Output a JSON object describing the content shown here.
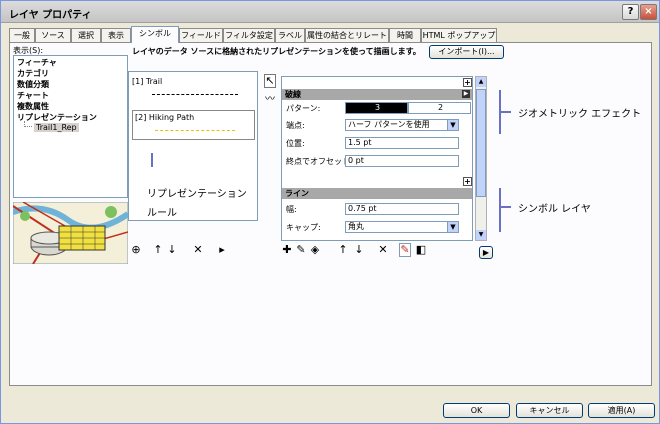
{
  "window": {
    "title": "レイヤ プロパティ",
    "help_label": "?",
    "close_label": "×"
  },
  "tabs": [
    {
      "label": "一般"
    },
    {
      "label": "ソース"
    },
    {
      "label": "選択"
    },
    {
      "label": "表示"
    },
    {
      "label": "シンボル",
      "active": true
    },
    {
      "label": "フィールド"
    },
    {
      "label": "フィルタ設定"
    },
    {
      "label": "ラベル"
    },
    {
      "label": "属性の結合とリレート"
    },
    {
      "label": "時間"
    },
    {
      "label": "HTML ポップアップ"
    }
  ],
  "show": {
    "label": "表示(S):",
    "items": [
      {
        "label": "フィーチャ"
      },
      {
        "label": "カテゴリ"
      },
      {
        "label": "数値分類"
      },
      {
        "label": "チャート"
      },
      {
        "label": "複数属性"
      },
      {
        "label": "リプレゼンテーション"
      }
    ],
    "subitem": "Trail1_Rep"
  },
  "description": "レイヤのデータ ソースに格納されたリプレゼンテーションを使って描画します。",
  "import_button": "インポート(I)...",
  "rules": [
    {
      "label": "[1] Trail",
      "color": "#000000"
    },
    {
      "label": "[2] Hiking Path",
      "color": "#e8c200"
    }
  ],
  "properties": {
    "section_dash": "破線",
    "pattern_label": "パターン:",
    "pattern_values": [
      "3",
      "2"
    ],
    "endpoints_label": "端点:",
    "endpoints_value": "ハーフ パターンを使用",
    "position_label": "位置:",
    "position_value": "1.5 pt",
    "offset_label": "終点でオフセット:",
    "offset_value": "0 pt",
    "section_line": "ライン",
    "width_label": "幅:",
    "width_value": "0.75 pt",
    "cap_label": "キャップ:",
    "cap_value": "角丸"
  },
  "callouts": {
    "rep_rules": [
      "リプレゼンテーション",
      "ルール"
    ],
    "geometric_effects": "ジオメトリック エフェクト",
    "symbol_layers": "シンボル レイヤ"
  },
  "footer": {
    "ok": "OK",
    "cancel": "キャンセル",
    "apply": "適用(A)"
  },
  "colors": {
    "accent_line": "#6a6fc8",
    "section_header": "#a8a8a8"
  }
}
